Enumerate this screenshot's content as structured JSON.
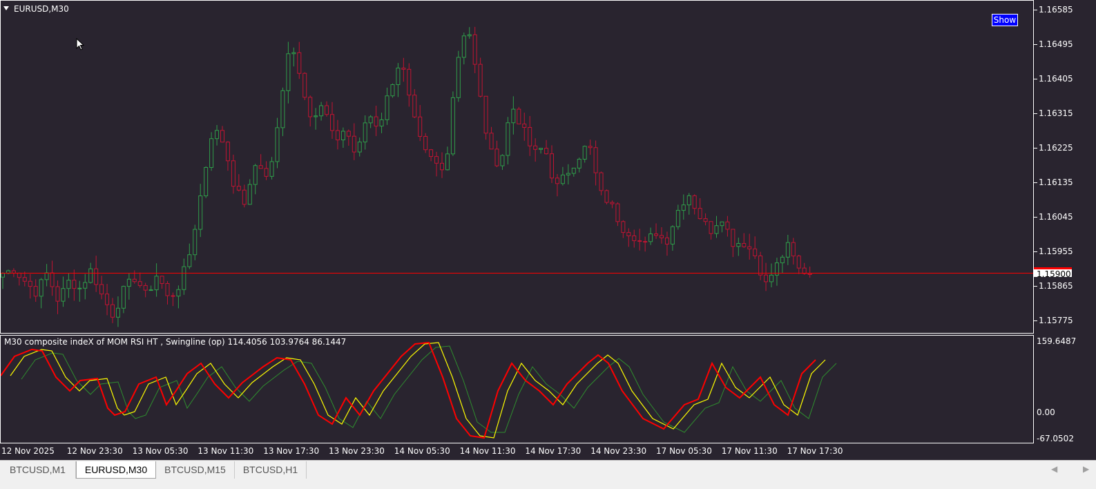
{
  "main_chart": {
    "title": "EURUSD,M30",
    "show_button_label": "Show",
    "current_price": "1.15900",
    "price_levels": [
      "1.16585",
      "1.16495",
      "1.16405",
      "1.16315",
      "1.16225",
      "1.16135",
      "1.16045",
      "1.15955",
      "1.15865",
      "1.15775"
    ],
    "colors": {
      "background": "#29242f",
      "bull_candle": "#2f9e4a",
      "bear_candle": "#c21432",
      "price_line": "#ff0000"
    }
  },
  "indicator": {
    "title": "M30 composite indeX of MOM RSI HT , Swingline (op)  114.4056 103.9764 86.1447",
    "levels": [
      "159.6487",
      "0.00",
      "-67.0502"
    ],
    "colors": {
      "line1": "#ff0000",
      "line2": "#ffff00",
      "line3": "#2f8f2f"
    }
  },
  "time_axis": [
    "12 Nov 2025",
    "12 Nov 23:30",
    "13 Nov 05:30",
    "13 Nov 11:30",
    "13 Nov 17:30",
    "13 Nov 23:30",
    "14 Nov 05:30",
    "14 Nov 11:30",
    "14 Nov 17:30",
    "14 Nov 23:30",
    "17 Nov 05:30",
    "17 Nov 11:30",
    "17 Nov 17:30"
  ],
  "tabs": [
    {
      "label": "BTCUSD,M1",
      "active": false
    },
    {
      "label": "EURUSD,M30",
      "active": true
    },
    {
      "label": "BTCUSD,M15",
      "active": false
    },
    {
      "label": "BTCUSD,H1",
      "active": false
    }
  ],
  "scroll": {
    "left_icon": "triangle-left-icon",
    "right_icon": "triangle-right-icon"
  },
  "chart_data": {
    "type": "candlestick",
    "symbol": "EURUSD",
    "timeframe": "M30",
    "ylim": [
      1.15735,
      1.16625
    ],
    "grid": false,
    "current_price": 1.159,
    "close_path": [
      1.159,
      1.1591,
      1.1588,
      1.1585,
      1.159,
      1.1583,
      1.1588,
      1.1586,
      1.1591,
      1.1584,
      1.1579,
      1.1586,
      1.1589,
      1.1584,
      1.159,
      1.1583,
      1.1587,
      1.1596,
      1.1612,
      1.1628,
      1.1624,
      1.1612,
      1.1608,
      1.162,
      1.1614,
      1.163,
      1.1652,
      1.164,
      1.163,
      1.1634,
      1.1624,
      1.1628,
      1.162,
      1.1632,
      1.1628,
      1.1638,
      1.1646,
      1.1632,
      1.1622,
      1.1619,
      1.1616,
      1.1644,
      1.1656,
      1.1639,
      1.1622,
      1.1618,
      1.1634,
      1.1628,
      1.1621,
      1.1623,
      1.1612,
      1.1616,
      1.162,
      1.1624,
      1.1611,
      1.1608,
      1.1602,
      1.16,
      1.1597,
      1.1601,
      1.1598,
      1.1606,
      1.1611,
      1.1605,
      1.1601,
      1.1605,
      1.1598,
      1.1598,
      1.1595,
      1.1587,
      1.1592,
      1.1597,
      1.1591,
      1.159
    ]
  }
}
